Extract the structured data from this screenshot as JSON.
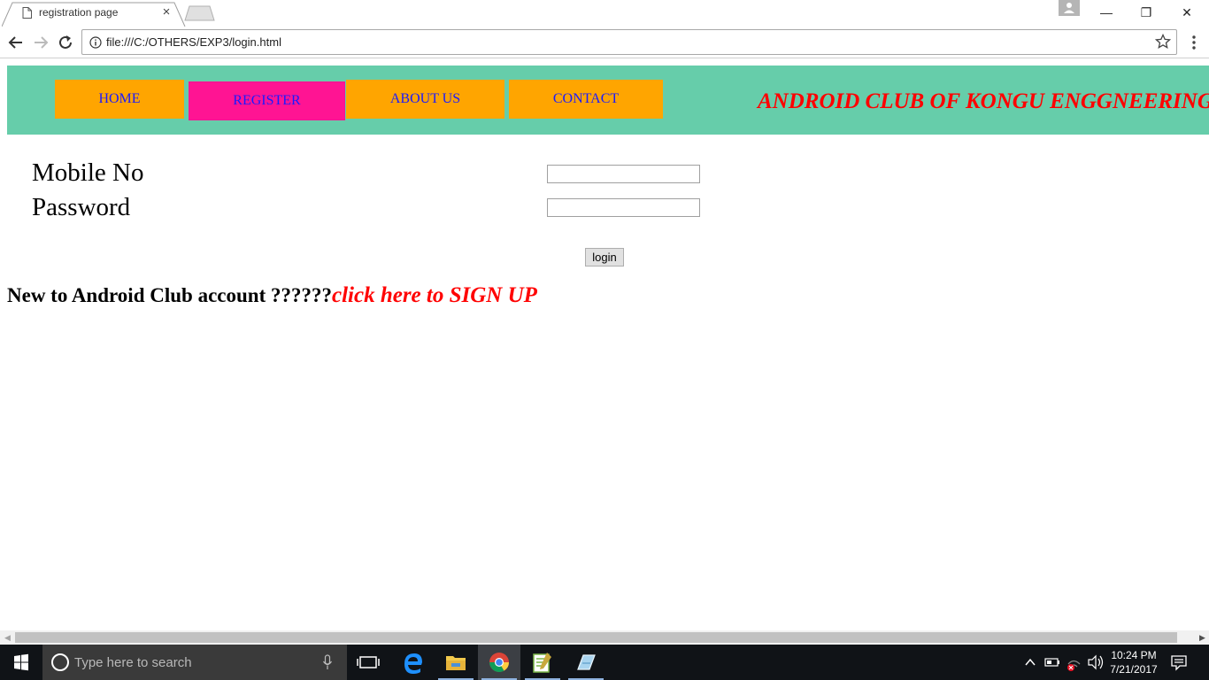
{
  "browser": {
    "tab_title": "registration page",
    "tab_close": "×",
    "url": "file:///C:/OTHERS/EXP3/login.html"
  },
  "window": {
    "minimize": "—",
    "maximize": "❐",
    "close": "✕"
  },
  "nav": {
    "items": [
      {
        "label": "HOME",
        "active": false
      },
      {
        "label": "REGISTER",
        "active": true
      },
      {
        "label": "ABOUT US",
        "active": false
      },
      {
        "label": "CONTACT",
        "active": false
      }
    ],
    "club_title": "ANDROID CLUB OF KONGU ENGGNEERING"
  },
  "form": {
    "mobile_label": "Mobile No",
    "mobile_value": "",
    "password_label": "Password",
    "password_value": "",
    "login_label": "login"
  },
  "signup": {
    "question": "New to Android Club account ??????",
    "link": "click here to SIGN UP"
  },
  "colors": {
    "header_bg": "#66cdaa",
    "nav_bg": "#ffa500",
    "nav_active_bg": "#ff1493",
    "nav_text": "#1a1aff",
    "accent_red": "#ff0000"
  },
  "taskbar": {
    "search_placeholder": "Type here to search",
    "time": "10:24 PM",
    "date": "7/21/2017"
  }
}
